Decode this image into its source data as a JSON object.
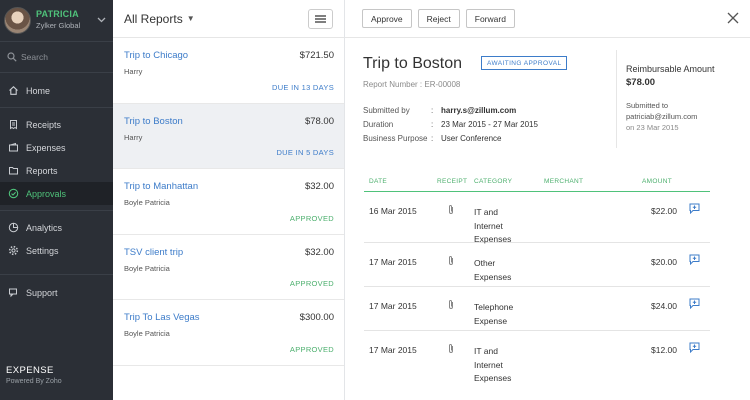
{
  "sidebar": {
    "user_name": "PATRICIA",
    "org_name": "Zylker Global",
    "search_placeholder": "Search",
    "nav": {
      "home": "Home",
      "receipts": "Receipts",
      "expenses": "Expenses",
      "reports": "Reports",
      "approvals": "Approvals",
      "analytics": "Analytics",
      "settings": "Settings",
      "support": "Support"
    },
    "brand": "EXPENSE",
    "brand_sub": "Powered By Zoho",
    "accent_color": "#4fc27a"
  },
  "list": {
    "title": "All Reports",
    "reports": [
      {
        "name": "Trip to Chicago",
        "amount": "$721.50",
        "person": "Harry",
        "status": "DUE IN 13 DAYS"
      },
      {
        "name": "Trip to Boston",
        "amount": "$78.00",
        "person": "Harry",
        "status": "DUE IN 5 DAYS"
      },
      {
        "name": "Trip to Manhattan",
        "amount": "$32.00",
        "person": "Boyle Patricia",
        "status": "APPROVED"
      },
      {
        "name": "TSV client trip",
        "amount": "$32.00",
        "person": "Boyle Patricia",
        "status": "APPROVED"
      },
      {
        "name": "Trip To Las Vegas",
        "amount": "$300.00",
        "person": "Boyle Patricia",
        "status": "APPROVED"
      }
    ]
  },
  "detail": {
    "actions": {
      "approve": "Approve",
      "reject": "Reject",
      "forward": "Forward"
    },
    "title": "Trip to Boston",
    "badge": "AWAITING APPROVAL",
    "report_number": "Report Number : ER-00008",
    "meta": {
      "submitted_by_label": "Submitted by",
      "submitted_by": "harry.s@zillum.com",
      "duration_label": "Duration",
      "duration": "23 Mar 2015 - 27 Mar 2015",
      "purpose_label": "Business Purpose",
      "purpose": "User Conference",
      "colon": ":"
    },
    "reimbursable_label": "Reimbursable Amount",
    "reimbursable_amount": "$78.00",
    "submitted_to_label": "Submitted to",
    "submitted_to_email": "patriciab@zillum.com",
    "submitted_to_date": "on 23 Mar 2015",
    "table": {
      "headers": {
        "date": "DATE",
        "receipt": "RECEIPT",
        "category": "CATEGORY",
        "merchant": "MERCHANT",
        "amount": "AMOUNT"
      },
      "rows": [
        {
          "date": "16 Mar 2015",
          "category": [
            "IT and",
            "Internet",
            "Expenses"
          ],
          "merchant": "",
          "amount": "$22.00"
        },
        {
          "date": "17 Mar 2015",
          "category": [
            "Other",
            "Expenses"
          ],
          "merchant": "",
          "amount": "$20.00"
        },
        {
          "date": "17 Mar 2015",
          "category": [
            "Telephone",
            "Expense"
          ],
          "merchant": "",
          "amount": "$24.00"
        },
        {
          "date": "17 Mar 2015",
          "category": [
            "IT and",
            "Internet",
            "Expenses"
          ],
          "merchant": "",
          "amount": "$12.00"
        }
      ]
    }
  }
}
